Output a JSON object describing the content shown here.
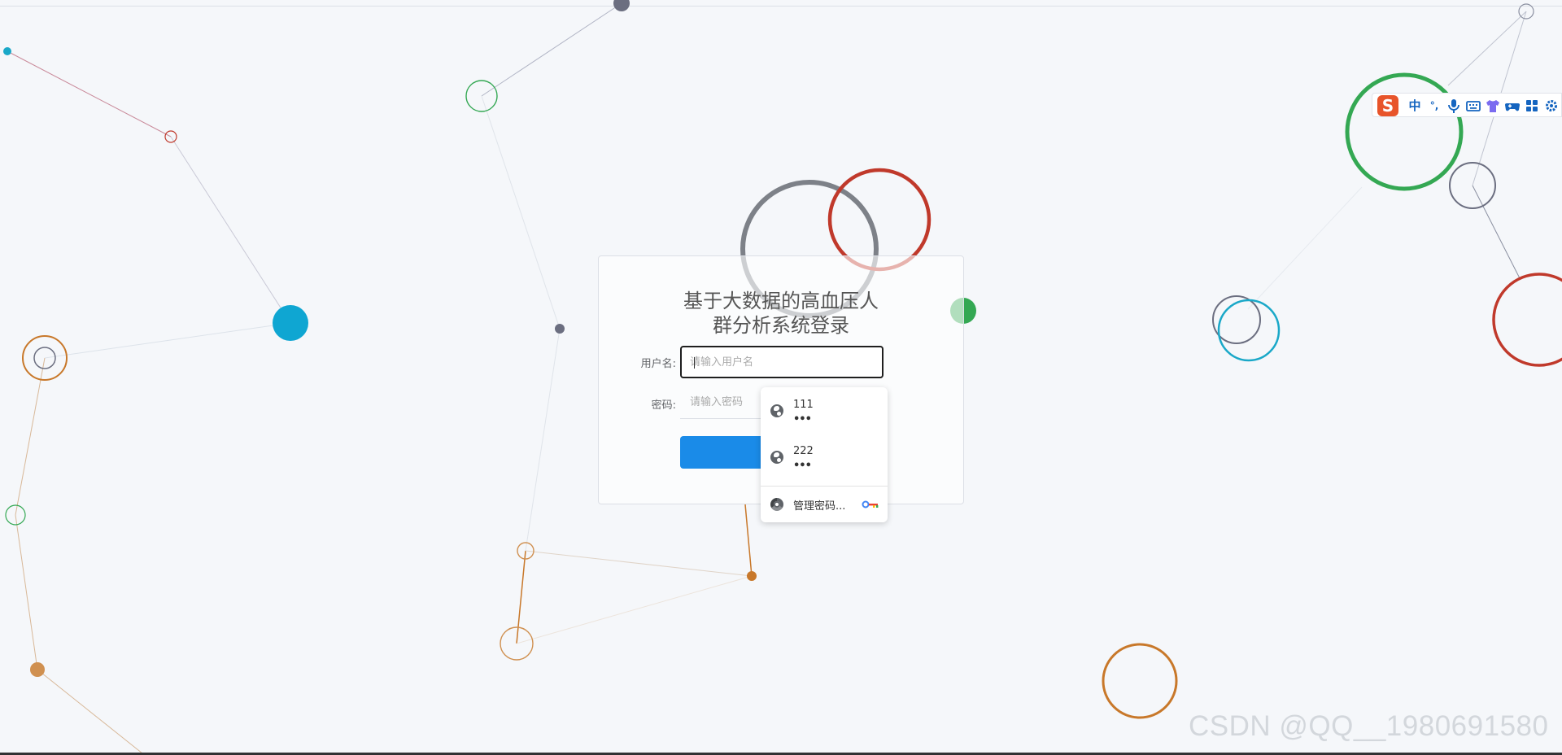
{
  "login": {
    "title_line1": "基于大数据的高血压人",
    "title_line2": "群分析系统登录",
    "username_label": "用户名:",
    "username_placeholder": "请输入用户名",
    "password_label": "密码:",
    "password_placeholder": "请输入密码",
    "button_color": "#1a8be8"
  },
  "autocomplete": {
    "items": [
      {
        "username": "111",
        "password_mask": "•••"
      },
      {
        "username": "222",
        "password_mask": "•••"
      }
    ],
    "manage_label": "管理密码..."
  },
  "ime": {
    "logo": "S",
    "items": [
      "中",
      "°,",
      "mic-icon",
      "keyboard-icon",
      "shirt-icon",
      "gamepad-icon",
      "grid-icon",
      "gear-icon"
    ]
  },
  "watermark": "CSDN @QQ__1980691580",
  "colors": {
    "background": "#f5f7fa",
    "accent": "#1a8be8",
    "node_green": "#34a853",
    "node_red": "#c0392b",
    "node_orange": "#c8782a",
    "node_teal": "#1aa8c8",
    "node_gray": "#6b6e80"
  }
}
